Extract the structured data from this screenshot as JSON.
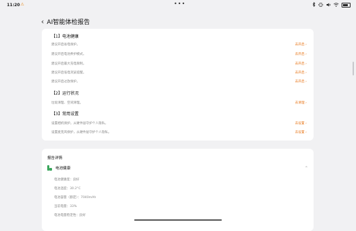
{
  "status": {
    "time": "11:20",
    "warning": "⚠",
    "dots": "•••"
  },
  "header": {
    "back": "‹",
    "title": "AI智能体检报告"
  },
  "sections": {
    "battery": {
      "title": "【1】电池健康",
      "rows": [
        {
          "text": "建议开启省电保护。",
          "action": "去开启 ›"
        },
        {
          "text": "建议开启电池养护模式。",
          "action": "去开启 ›"
        },
        {
          "text": "建议开启最大充电限制。",
          "action": "去开启 ›"
        },
        {
          "text": "建议开启低电浏览提醒。",
          "action": "去开启 ›"
        },
        {
          "text": "建议开启过放保护。",
          "action": "去开启 ›"
        }
      ]
    },
    "running": {
      "title": "【2】运行状况",
      "rows": [
        {
          "text": "垃圾清理、空间清理。",
          "action": "去清理 ›"
        }
      ]
    },
    "settings": {
      "title": "【3】常用设置",
      "rows": [
        {
          "text": "设置相机保护，从硬件层守护个人隐私。",
          "action": "去设置 ›"
        },
        {
          "text": "设置麦克风保护，从硬件层守护个人隐私。",
          "action": "去设置 ›"
        }
      ]
    }
  },
  "details": {
    "title": "报告详情",
    "item": "电池健康",
    "chevron": "⌃",
    "rows": [
      "电池健康度：良好",
      "电池温度：30.2°C",
      "电池容量（额定）：7040mAh",
      "当前电量：33%",
      "电池电量稳定性：良好"
    ]
  }
}
